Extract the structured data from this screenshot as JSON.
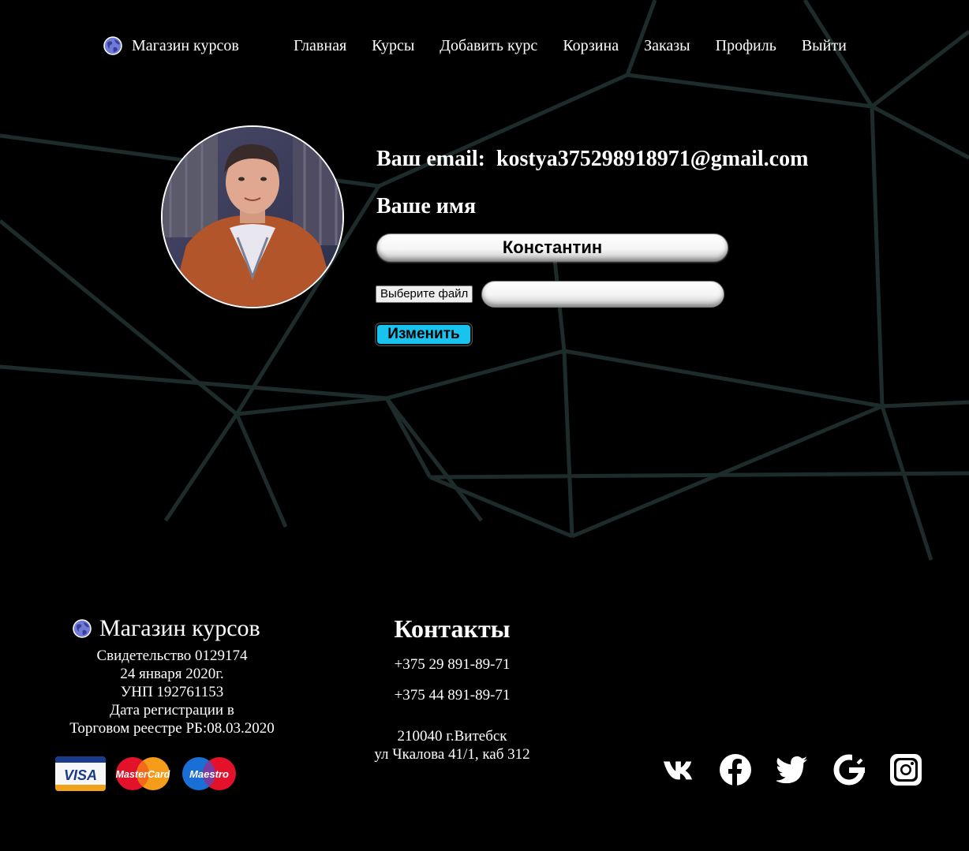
{
  "brand": {
    "name": "Магазин курсов",
    "icon": "globe-icon"
  },
  "nav": {
    "items": [
      "Главная",
      "Курсы",
      "Добавить курс",
      "Корзина",
      "Заказы",
      "Профиль",
      "Выйти"
    ]
  },
  "profile": {
    "email_label": "Ваш email:",
    "email": "kostya375298918971@gmail.com",
    "name_label": "Ваше имя",
    "name_value": "Константин",
    "file_button": "Выберите файл",
    "submit_label": "Изменить"
  },
  "footer": {
    "brand_name": "Магазин курсов",
    "info_lines": [
      "Свидетельство 0129174",
      "24 января 2020г.",
      "УНП 192761153",
      "Дата регистрации в",
      "Торговом реестре РБ:08.03.2020"
    ],
    "contacts_title": "Контакты",
    "phones": [
      "+375 29 891-89-71",
      "+375 44 891-89-71"
    ],
    "address_lines": [
      "210040 г.Витебск",
      "ул Чкалова 41/1, каб 312"
    ],
    "payment_cards": [
      {
        "name": "VISA",
        "icon": "visa-icon"
      },
      {
        "name": "MasterCard",
        "icon": "mastercard-icon"
      },
      {
        "name": "Maestro",
        "icon": "maestro-icon"
      }
    ],
    "social_icons": [
      "vk-icon",
      "facebook-icon",
      "twitter-icon",
      "google-icon",
      "instagram-icon"
    ]
  },
  "colors": {
    "background": "#000000",
    "line_pattern": "#1c2a2a",
    "submit_button": "#19c3f0",
    "text": "#ffffff"
  }
}
